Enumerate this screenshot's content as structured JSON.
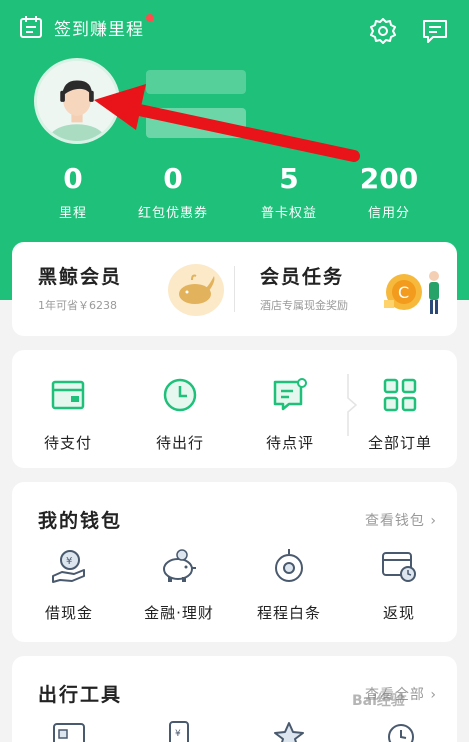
{
  "topbar": {
    "checkin_label": "签到赚里程",
    "checkin_icon": "calendar-icon",
    "settings_icon": "gear-icon",
    "messages_icon": "message-icon"
  },
  "stats": [
    {
      "value": "0",
      "label": "里程"
    },
    {
      "value": "0",
      "label": "红包优惠券"
    },
    {
      "value": "5",
      "label": "普卡权益"
    },
    {
      "value": "200",
      "label": "信用分"
    }
  ],
  "member": {
    "title": "黑鲸会员",
    "subtitle": "1年可省￥6238",
    "task_title": "会员任务",
    "task_subtitle": "酒店专属现金奖励"
  },
  "orders": [
    {
      "label": "待支付",
      "icon": "wallet-card-icon"
    },
    {
      "label": "待出行",
      "icon": "clock-icon"
    },
    {
      "label": "待点评",
      "icon": "comment-icon"
    },
    {
      "label": "全部订单",
      "icon": "grid-icon"
    }
  ],
  "wallet": {
    "title": "我的钱包",
    "link": "查看钱包 ›",
    "items": [
      {
        "label": "借现金",
        "icon": "cash-hand-icon"
      },
      {
        "label": "金融·理财",
        "icon": "piggy-bank-icon"
      },
      {
        "label": "程程白条",
        "icon": "target-icon"
      },
      {
        "label": "返现",
        "icon": "cashback-card-icon"
      }
    ]
  },
  "tools": {
    "title": "出行工具",
    "link": "查看全部 ›"
  },
  "watermark": "Bai经验",
  "colors": {
    "brand_green": "#1ec07a",
    "arrow_red": "#e8141a"
  }
}
